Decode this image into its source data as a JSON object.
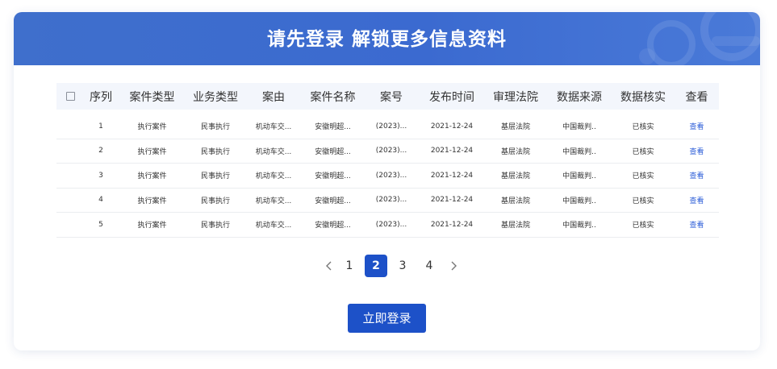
{
  "banner": {
    "title": "请先登录 解锁更多信息资料"
  },
  "table": {
    "headers": [
      "序列",
      "案件类型",
      "业务类型",
      "案由",
      "案件名称",
      "案号",
      "发布时间",
      "审理法院",
      "数据来源",
      "数据核实",
      "查看"
    ],
    "rows": [
      [
        "1",
        "执行案件",
        "民事执行",
        "机动车交...",
        "安徽明超...",
        "(2023)...",
        "2021-12-24",
        "基层法院",
        "中国裁判..",
        "已核实",
        "查看"
      ],
      [
        "2",
        "执行案件",
        "民事执行",
        "机动车交...",
        "安徽明超...",
        "(2023)...",
        "2021-12-24",
        "基层法院",
        "中国裁判..",
        "已核实",
        "查看"
      ],
      [
        "3",
        "执行案件",
        "民事执行",
        "机动车交...",
        "安徽明超...",
        "(2023)...",
        "2021-12-24",
        "基层法院",
        "中国裁判..",
        "已核实",
        "查看"
      ],
      [
        "4",
        "执行案件",
        "民事执行",
        "机动车交...",
        "安徽明超...",
        "(2023)...",
        "2021-12-24",
        "基层法院",
        "中国裁判..",
        "已核实",
        "查看"
      ],
      [
        "5",
        "执行案件",
        "民事执行",
        "机动车交...",
        "安徽明超...",
        "(2023)...",
        "2021-12-24",
        "基层法院",
        "中国裁判..",
        "已核实",
        "查看"
      ]
    ]
  },
  "pagination": {
    "pages": [
      "1",
      "2",
      "3",
      "4"
    ],
    "current": "2",
    "prev_icon": "chevron-left-icon",
    "next_icon": "chevron-right-icon"
  },
  "login_button": {
    "label": "立即登录"
  },
  "colors": {
    "banner": "#3f6fcc",
    "accent": "#1d51c8",
    "link": "#2a5bd7",
    "header_bg": "#f3f6fc"
  }
}
